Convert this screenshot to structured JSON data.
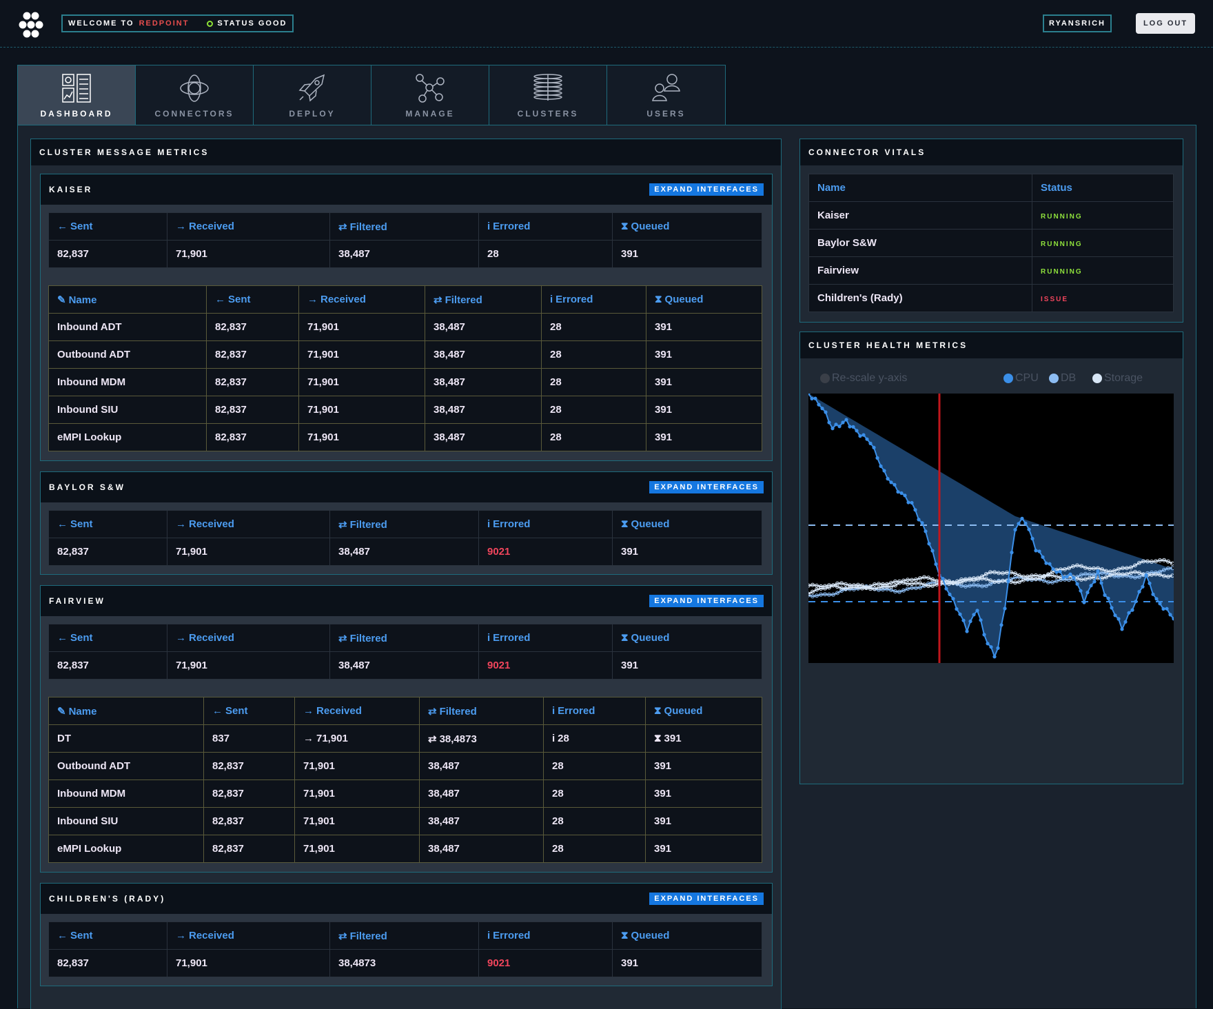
{
  "header": {
    "welcome_prefix": "WELCOME TO",
    "brand": "REDPOINT",
    "status": "STATUS GOOD",
    "username": "RYANSRICH",
    "logout": "LOG OUT"
  },
  "tabs": [
    {
      "label": "DASHBOARD",
      "icon": "dashboard-icon"
    },
    {
      "label": "CONNECTORS",
      "icon": "connectors-icon"
    },
    {
      "label": "DEPLOY",
      "icon": "rocket-icon"
    },
    {
      "label": "MANAGE",
      "icon": "network-icon"
    },
    {
      "label": "CLUSTERS",
      "icon": "server-stack-icon"
    },
    {
      "label": "USERS",
      "icon": "users-icon"
    }
  ],
  "metrics_panel": {
    "title": "CLUSTER MESSAGE METRICS",
    "expand_label": "EXPAND INTERFACES"
  },
  "columns": {
    "name": "Name",
    "sent": "Sent",
    "received": "Received",
    "filtered": "Filtered",
    "errored": "Errored",
    "queued": "Queued"
  },
  "clusters": [
    {
      "name": "KAISER",
      "summary": {
        "sent": "82,837",
        "received": "71,901",
        "filtered": "38,487",
        "errored": "28",
        "queued": "391"
      },
      "interfaces": [
        {
          "name": "Inbound ADT",
          "sent": "82,837",
          "received": "71,901",
          "filtered": "38,487",
          "errored": "28",
          "queued": "391"
        },
        {
          "name": "Outbound ADT",
          "sent": "82,837",
          "received": "71,901",
          "filtered": "38,487",
          "errored": "28",
          "queued": "391"
        },
        {
          "name": "Inbound MDM",
          "sent": "82,837",
          "received": "71,901",
          "filtered": "38,487",
          "errored": "28",
          "queued": "391"
        },
        {
          "name": "Inbound SIU",
          "sent": "82,837",
          "received": "71,901",
          "filtered": "38,487",
          "errored": "28",
          "queued": "391"
        },
        {
          "name": "eMPI Lookup",
          "sent": "82,837",
          "received": "71,901",
          "filtered": "38,487",
          "errored": "28",
          "queued": "391"
        }
      ]
    },
    {
      "name": "BAYLOR S&W",
      "summary": {
        "sent": "82,837",
        "received": "71,901",
        "filtered": "38,487",
        "errored": "9021",
        "queued": "391"
      }
    },
    {
      "name": "FAIRVIEW",
      "summary": {
        "sent": "82,837",
        "received": "71,901",
        "filtered": "38,487",
        "errored": "9021",
        "queued": "391"
      },
      "interfaces": [
        {
          "name": "DT",
          "sent": "837",
          "received": "71,901",
          "filtered": "38,4873",
          "errored": "28",
          "queued": "391"
        },
        {
          "name": "Outbound ADT",
          "sent": "82,837",
          "received": "71,901",
          "filtered": "38,487",
          "errored": "28",
          "queued": "391"
        },
        {
          "name": "Inbound MDM",
          "sent": "82,837",
          "received": "71,901",
          "filtered": "38,487",
          "errored": "28",
          "queued": "391"
        },
        {
          "name": "Inbound SIU",
          "sent": "82,837",
          "received": "71,901",
          "filtered": "38,487",
          "errored": "28",
          "queued": "391"
        },
        {
          "name": "eMPI Lookup",
          "sent": "82,837",
          "received": "71,901",
          "filtered": "38,487",
          "errored": "28",
          "queued": "391"
        }
      ]
    },
    {
      "name": "CHILDREN'S (RADY)",
      "summary": {
        "sent": "82,837",
        "received": "71,901",
        "filtered": "38,4873",
        "errored": "9021",
        "queued": "391"
      }
    }
  ],
  "vitals": {
    "title": "CONNECTOR VITALS",
    "col_name": "Name",
    "col_status": "Status",
    "rows": [
      {
        "name": "Kaiser",
        "status": "RUNNING"
      },
      {
        "name": "Baylor S&W",
        "status": "RUNNING"
      },
      {
        "name": "Fairview",
        "status": "RUNNING"
      },
      {
        "name": "Children's (Rady)",
        "status": "ISSUE"
      }
    ]
  },
  "health": {
    "title": "CLUSTER HEALTH METRICS",
    "rescale_label": "Re-scale y-axis",
    "legend": [
      {
        "label": "CPU",
        "color": "#3b8fe8"
      },
      {
        "label": "DB",
        "color": "#8cbcf2"
      },
      {
        "label": "Storage",
        "color": "#d8e6f6"
      }
    ]
  },
  "colors": {
    "accent": "#1577e0",
    "running": "#8ee03c",
    "issue": "#f0455c",
    "brand": "#e84d4d"
  }
}
